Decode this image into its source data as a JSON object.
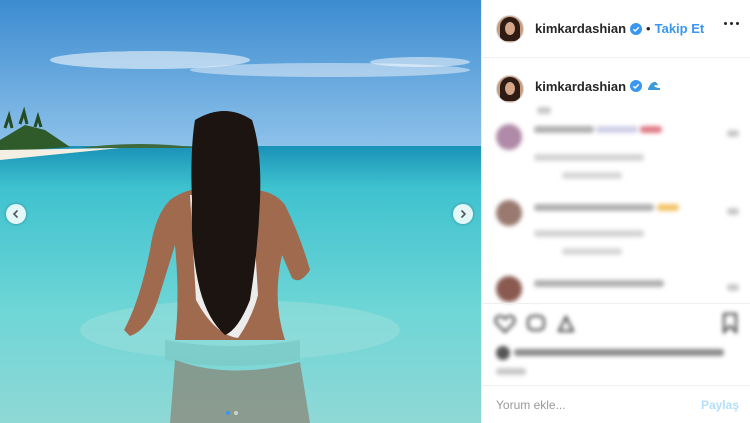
{
  "header": {
    "username": "kimkardashian",
    "separator": "•",
    "follow_label": "Takip Et"
  },
  "caption": {
    "username": "kimkardashian"
  },
  "comment_box": {
    "placeholder": "Yorum ekle...",
    "post_label": "Paylaş"
  },
  "icons": {
    "verified": "verified-badge-icon",
    "wave": "water-wave-emoji-icon",
    "more": "more-options-icon",
    "prev": "chevron-left-icon",
    "next": "chevron-right-icon"
  },
  "carousel": {
    "slide_count": 2,
    "active_index": 0
  },
  "colors": {
    "accent": "#3897f0",
    "text": "#262626",
    "border": "#efefef",
    "post_disabled": "#b2dffc"
  }
}
